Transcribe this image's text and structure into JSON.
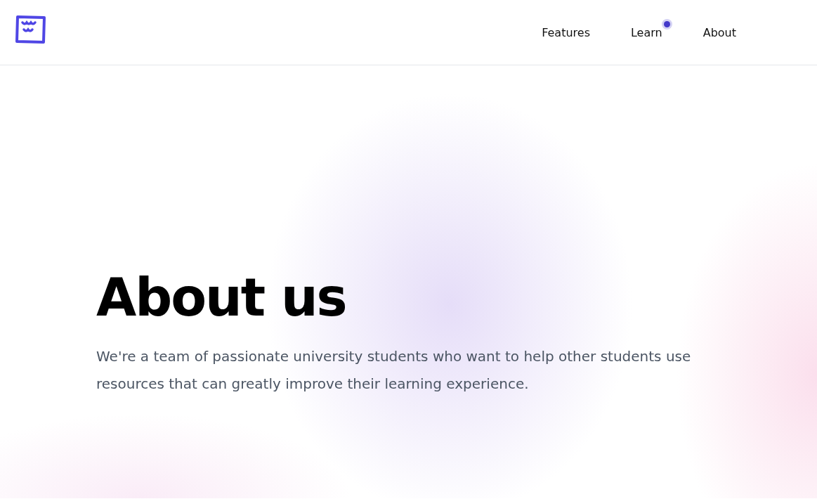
{
  "nav": {
    "items": [
      {
        "label": "Features",
        "dot": false
      },
      {
        "label": "Learn",
        "dot": true
      },
      {
        "label": "About",
        "dot": false
      }
    ]
  },
  "hero": {
    "title": "About us",
    "text": "We're a team of passionate university students who want to help other students use resources that can greatly improve their learning experience."
  }
}
